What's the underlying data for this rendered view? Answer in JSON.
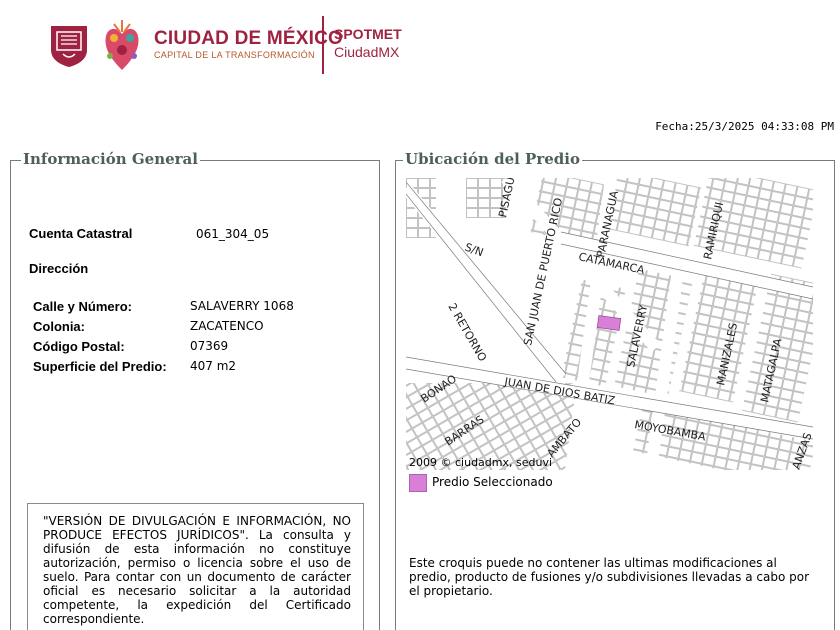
{
  "header": {
    "title": "CIUDAD DE MÉXICO",
    "subtitle": "CAPITAL DE LA TRANSFORMACIÓN",
    "app_name": "SPOTMET",
    "app_sub": "CiudadMX"
  },
  "fecha": "Fecha:25/3/2025 04:33:08 PM",
  "info": {
    "title": "Información General",
    "cuenta_label": "Cuenta Catastral",
    "cuenta_value": "061_304_05",
    "direccion_label": "Dirección",
    "calle_label": "Calle y Número:",
    "calle_value": "SALAVERRY 1068",
    "colonia_label": "Colonia:",
    "colonia_value": "ZACATENCO",
    "cp_label": "Código Postal:",
    "cp_value": "07369",
    "superficie_label": "Superficie del Predio:",
    "superficie_value": "407 m2",
    "disclaimer": "\"VERSIÓN DE DIVULGACIÓN E INFORMACIÓN, NO PRODUCE EFECTOS JURÍDICOS\". La consulta y difusión de esta información no constituye autorización, permiso o licencia sobre el uso de suelo. Para contar con un documento de carácter oficial es necesario solicitar a la autoridad competente, la expedición del Certificado correspondiente."
  },
  "ubicacion": {
    "title": "Ubicación del Predio",
    "map_credit": "2009 © ciudadmx, seduvi",
    "legend_label": "Predio Seleccionado",
    "note": "Este croquis puede no contener las ultimas modificaciones al predio, producto de fusiones y/o subdivisiones llevadas a cabo por el propietario.",
    "streets": [
      "PISAGUA",
      "SAN JUAN DE PUERTO RICO",
      "PARANAGUA",
      "RAMIRIQUI",
      "S/N",
      "CATAMARCA",
      "2 RETORNO",
      "SALAVERRY",
      "MANIZALES",
      "MATAGALPA",
      "BONAO",
      "JUAN DE DIOS BATIZ",
      "BARRAS",
      "AMBATO",
      "MOYOBAMBA",
      "ANZAS"
    ]
  },
  "colors": {
    "brand": "#9f2241",
    "panel_title": "#4c5f5a",
    "selected_parcel": "#d87fd8"
  }
}
